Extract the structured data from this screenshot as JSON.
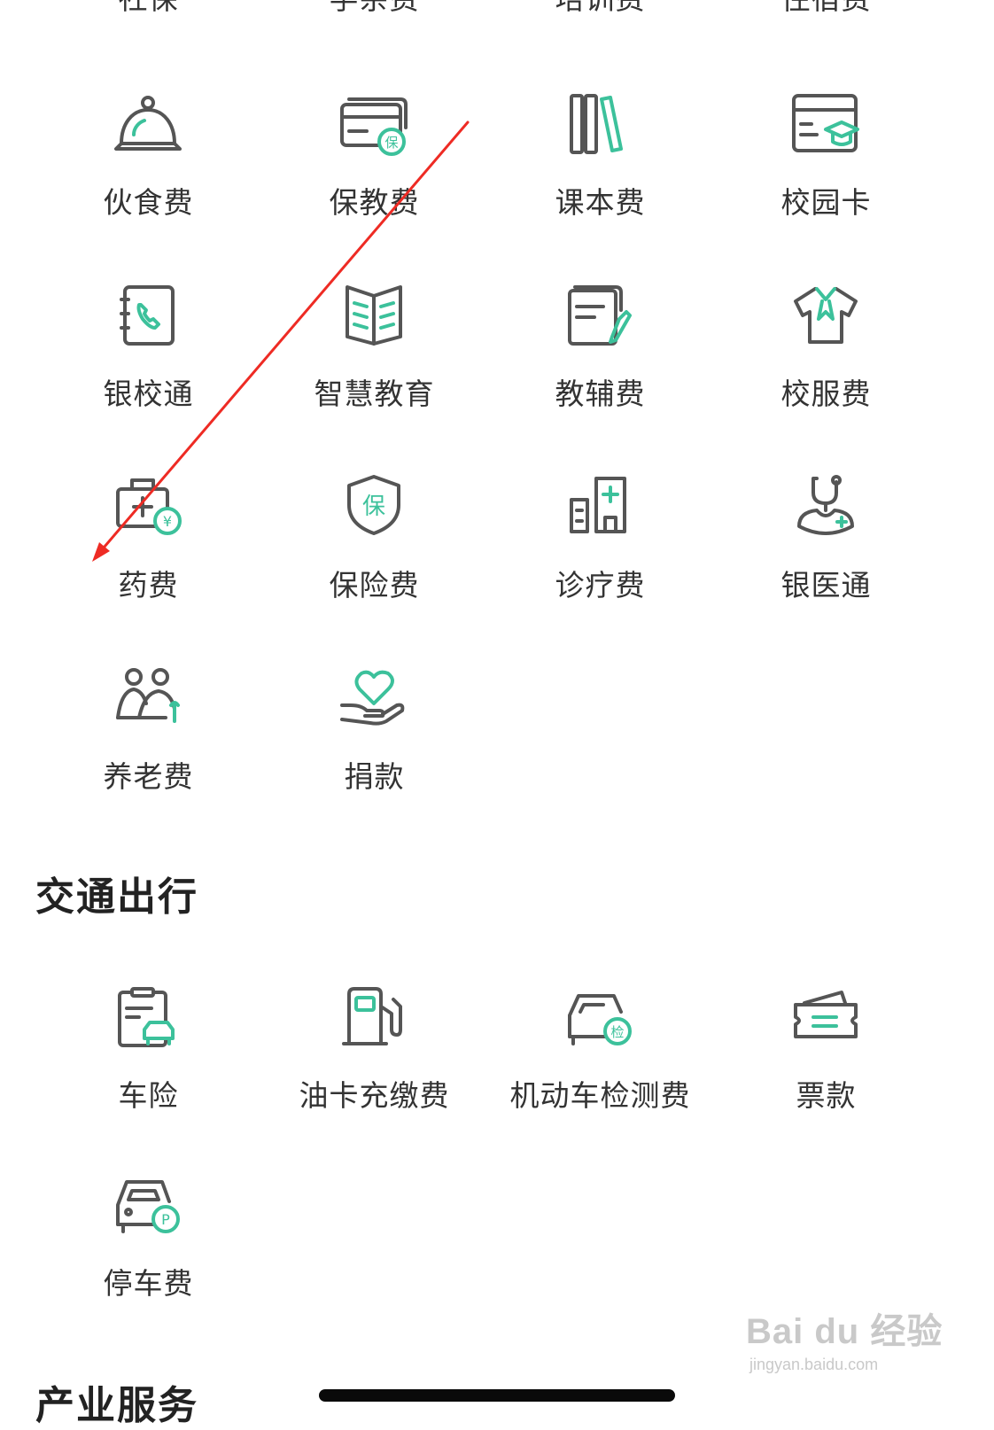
{
  "colors": {
    "icon_gray": "#555555",
    "icon_accent": "#3cc19b",
    "text": "#333333",
    "annotation_arrow": "#ee2b24"
  },
  "top_row_partial": [
    "社保",
    "学杂费",
    "培训费",
    "住宿费"
  ],
  "education_grid": [
    [
      {
        "label": "伙食费",
        "icon": "cloche-icon"
      },
      {
        "label": "保教费",
        "icon": "card-shield-icon",
        "badge": "保"
      },
      {
        "label": "课本费",
        "icon": "books-icon"
      },
      {
        "label": "校园卡",
        "icon": "campus-card-icon"
      }
    ],
    [
      {
        "label": "银校通",
        "icon": "phone-book-icon"
      },
      {
        "label": "智慧教育",
        "icon": "open-book-icon"
      },
      {
        "label": "教辅费",
        "icon": "notebook-pen-icon"
      },
      {
        "label": "校服费",
        "icon": "uniform-shirt-icon"
      }
    ],
    [
      {
        "label": "药费",
        "icon": "medicine-kit-icon",
        "badge": "¥"
      },
      {
        "label": "保险费",
        "icon": "insurance-shield-icon",
        "badge": "保"
      },
      {
        "label": "诊疗费",
        "icon": "hospital-icon"
      },
      {
        "label": "银医通",
        "icon": "stethoscope-icon"
      }
    ],
    [
      {
        "label": "养老费",
        "icon": "elderly-couple-icon"
      },
      {
        "label": "捐款",
        "icon": "heart-hand-icon"
      }
    ]
  ],
  "transport_section": {
    "title": "交通出行",
    "grid": [
      [
        {
          "label": "车险",
          "icon": "car-insurance-icon"
        },
        {
          "label": "油卡充缴费",
          "icon": "fuel-pump-icon"
        },
        {
          "label": "机动车检测费",
          "icon": "car-inspection-icon",
          "badge": "检"
        },
        {
          "label": "票款",
          "icon": "ticket-icon"
        }
      ],
      [
        {
          "label": "停车费",
          "icon": "parking-icon",
          "badge": "P"
        }
      ]
    ]
  },
  "next_section_title_partial": "产业服务",
  "watermark": {
    "logo": "Bai du 经验",
    "url": "jingyan.baidu.com"
  }
}
